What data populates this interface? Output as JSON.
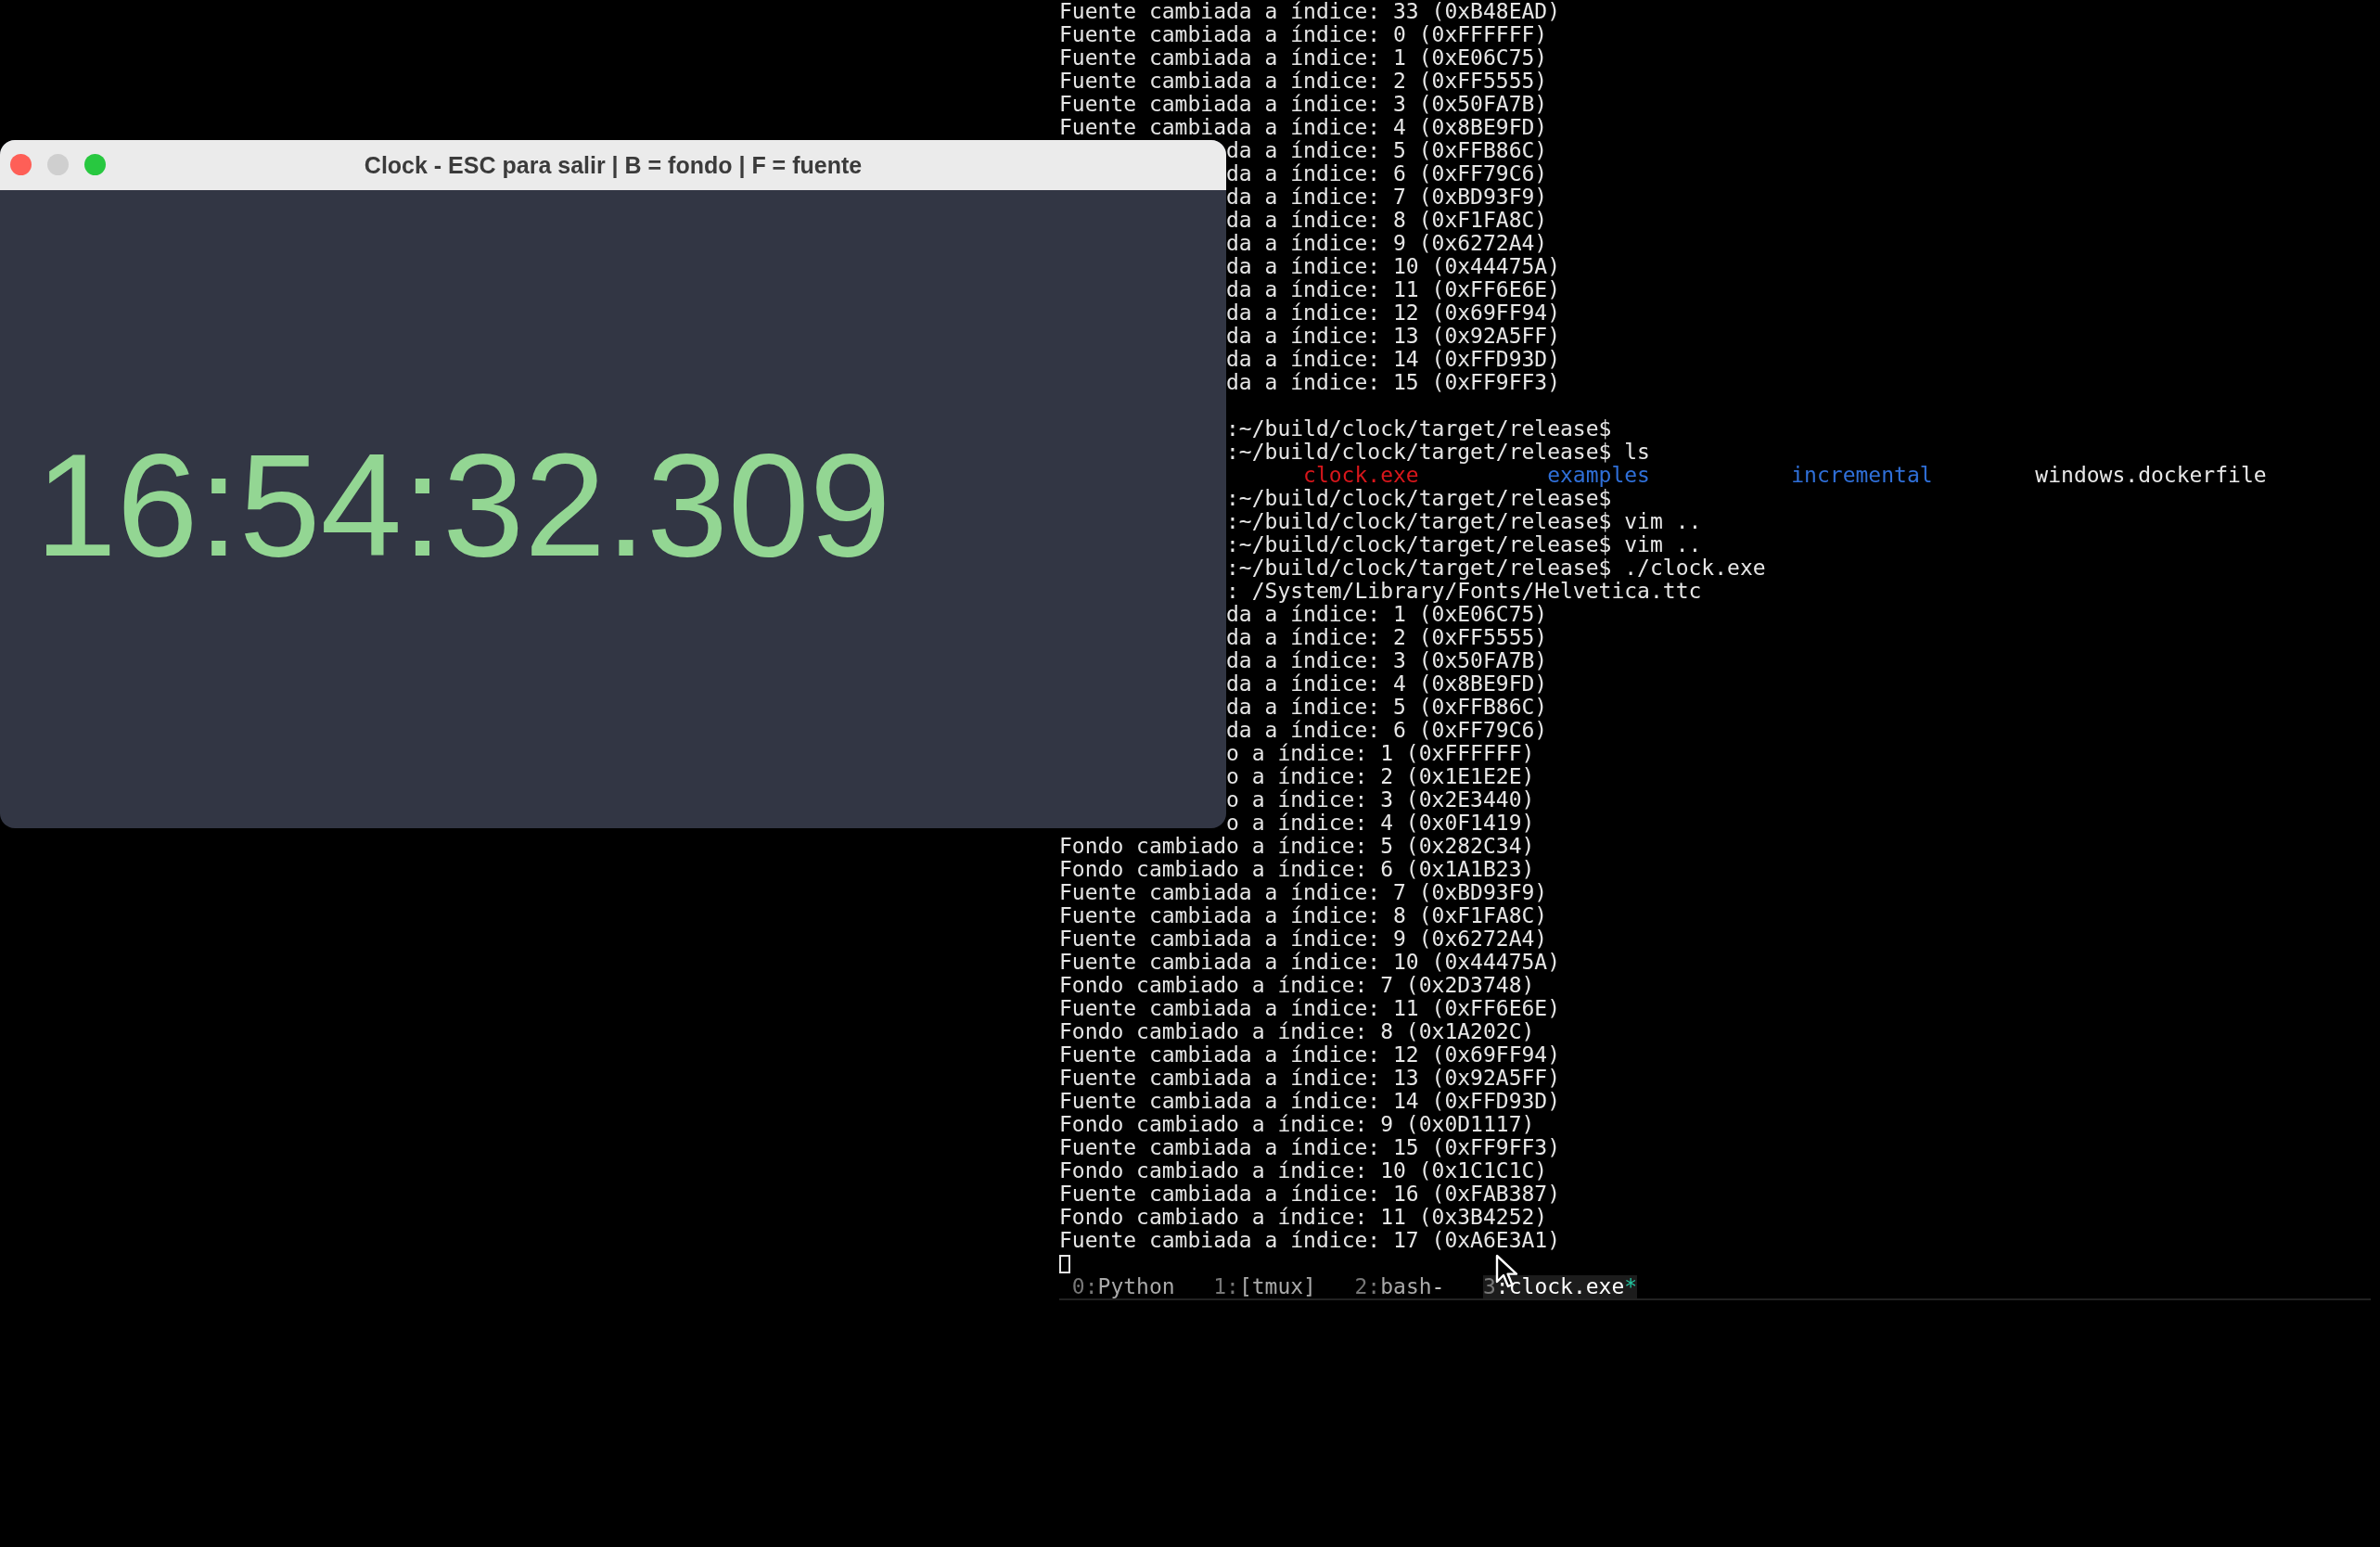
{
  "clock_window": {
    "title": "Clock - ESC para salir | B = fondo | F = fuente",
    "time": "16:54:32.309",
    "buttons": [
      {
        "kind": "close",
        "disabled": false
      },
      {
        "kind": "minimize",
        "disabled": true
      },
      {
        "kind": "zoom",
        "disabled": false
      }
    ]
  },
  "terminal": {
    "lines_top": [
      "Fuente cambiada a índice: 33 (0xB48EAD)",
      "Fuente cambiada a índice: 0 (0xFFFFFF)",
      "Fuente cambiada a índice: 1 (0xE06C75)",
      "Fuente cambiada a índice: 2 (0xFF5555)",
      "Fuente cambiada a índice: 3 (0x50FA7B)",
      "Fuente cambiada a índice: 4 (0x8BE9FD)"
    ],
    "blocks_beside_window": [
      [
        {
          "kind": "text",
          "text": "da a índice: 5 (0xFFB86C)"
        },
        {
          "kind": "text",
          "text": "da a índice: 6 (0xFF79C6)"
        },
        {
          "kind": "text",
          "text": "da a índice: 7 (0xBD93F9)"
        },
        {
          "kind": "text",
          "text": "da a índice: 8 (0xF1FA8C)"
        },
        {
          "kind": "text",
          "text": "da a índice: 9 (0x6272A4)"
        },
        {
          "kind": "text",
          "text": "da a índice: 10 (0x44475A)"
        },
        {
          "kind": "text",
          "text": "da a índice: 11 (0xFF6E6E)"
        },
        {
          "kind": "text",
          "text": "da a índice: 12 (0x69FF94)"
        },
        {
          "kind": "text",
          "text": "da a índice: 13 (0x92A5FF)"
        },
        {
          "kind": "text",
          "text": "da a índice: 14 (0xFFD93D)"
        },
        {
          "kind": "text",
          "text": "da a índice: 15 (0xFF9FF3)"
        }
      ],
      [
        {
          "kind": "text",
          "text": ":~/build/clock/target/release$"
        },
        {
          "kind": "text",
          "text": ":~/build/clock/target/release$ ls"
        },
        {
          "kind": "ls",
          "entries": [
            {
              "name": "clock.exe",
              "color": "#d8161b"
            },
            {
              "name": "examples",
              "color": "#2f6fd8"
            },
            {
              "name": "incremental",
              "color": "#2f6fd8"
            },
            {
              "name": "windows.dockerfile",
              "color": "#e8e8e8"
            }
          ]
        },
        {
          "kind": "text",
          "text": ":~/build/clock/target/release$"
        },
        {
          "kind": "text",
          "text": ":~/build/clock/target/release$ vim .."
        },
        {
          "kind": "text",
          "text": ":~/build/clock/target/release$ vim .."
        },
        {
          "kind": "text",
          "text": ":~/build/clock/target/release$ ./clock.exe"
        },
        {
          "kind": "text",
          "text": ": /System/Library/Fonts/Helvetica.ttc"
        },
        {
          "kind": "text",
          "text": "da a índice: 1 (0xE06C75)"
        },
        {
          "kind": "text",
          "text": "da a índice: 2 (0xFF5555)"
        },
        {
          "kind": "text",
          "text": "da a índice: 3 (0x50FA7B)"
        },
        {
          "kind": "text",
          "text": "da a índice: 4 (0x8BE9FD)"
        },
        {
          "kind": "text",
          "text": "da a índice: 5 (0xFFB86C)"
        },
        {
          "kind": "text",
          "text": "da a índice: 6 (0xFF79C6)"
        },
        {
          "kind": "text",
          "text": "o a índice: 1 (0xFFFFFF)"
        },
        {
          "kind": "text",
          "text": "o a índice: 2 (0x1E1E2E)"
        },
        {
          "kind": "text",
          "text": "o a índice: 3 (0x2E3440)"
        },
        {
          "kind": "text",
          "text": "o a índice: 4 (0x0F1419)"
        }
      ]
    ],
    "lines_bottom": [
      "Fondo cambiado a índice: 5 (0x282C34)",
      "Fondo cambiado a índice: 6 (0x1A1B23)",
      "Fuente cambiada a índice: 7 (0xBD93F9)",
      "Fuente cambiada a índice: 8 (0xF1FA8C)",
      "Fuente cambiada a índice: 9 (0x6272A4)",
      "Fuente cambiada a índice: 10 (0x44475A)",
      "Fondo cambiado a índice: 7 (0x2D3748)",
      "Fuente cambiada a índice: 11 (0xFF6E6E)",
      "Fondo cambiado a índice: 8 (0x1A202C)",
      "Fuente cambiada a índice: 12 (0x69FF94)",
      "Fuente cambiada a índice: 13 (0x92A5FF)",
      "Fuente cambiada a índice: 14 (0xFFD93D)",
      "Fondo cambiado a índice: 9 (0x0D1117)",
      "Fuente cambiada a índice: 15 (0xFF9FF3)",
      "Fondo cambiado a índice: 10 (0x1C1C1C)",
      "Fuente cambiada a índice: 16 (0xFAB387)",
      "Fondo cambiado a índice: 11 (0x3B4252)",
      "Fuente cambiada a índice: 17 (0xA6E3A1)"
    ],
    "status_bar": {
      "windows": [
        {
          "index": "0:",
          "name": "Python",
          "selected": false
        },
        {
          "index": "1:",
          "name": "[tmux]",
          "selected": false
        },
        {
          "index": "2:",
          "name": "bash",
          "flag": "-",
          "selected": false
        },
        {
          "index": "3",
          "name": ":clock.exe",
          "flag": "*",
          "selected": true
        }
      ]
    }
  }
}
